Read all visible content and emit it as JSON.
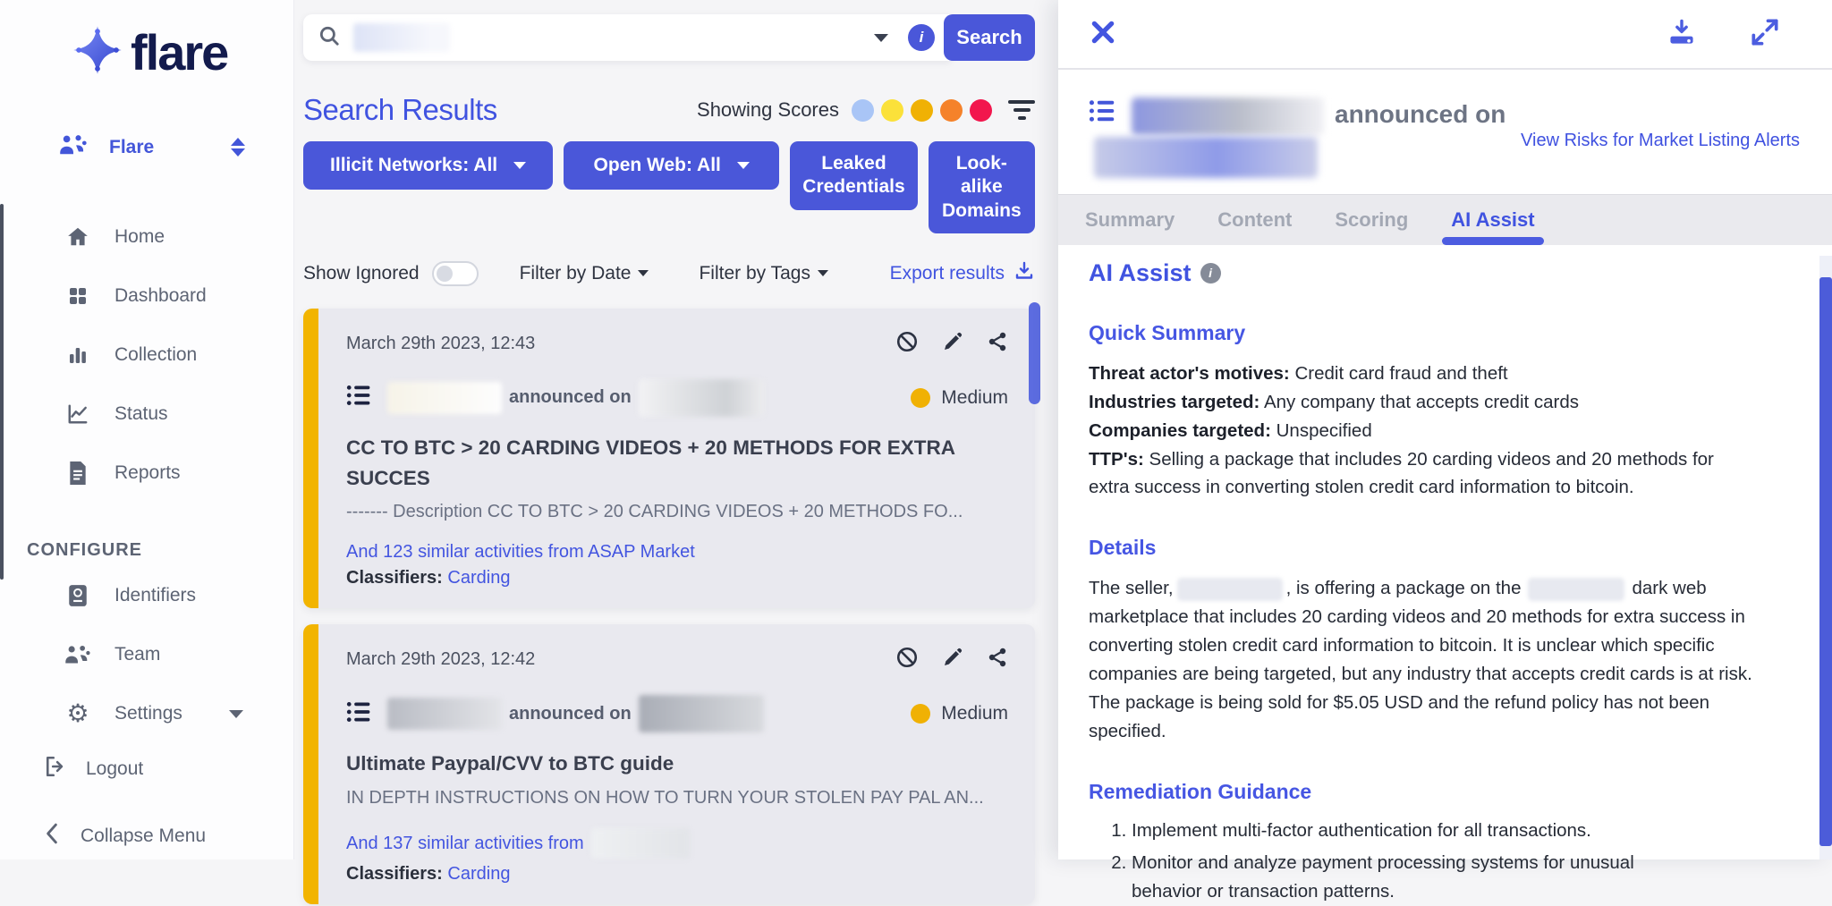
{
  "app": {
    "logo_text": "flare"
  },
  "sidebar": {
    "org": {
      "label": "Flare"
    },
    "items": [
      {
        "label": "Home"
      },
      {
        "label": "Dashboard"
      },
      {
        "label": "Collection"
      },
      {
        "label": "Status"
      },
      {
        "label": "Reports"
      }
    ],
    "configure_header": "CONFIGURE",
    "configure_items": [
      {
        "label": "Identifiers"
      },
      {
        "label": "Team"
      },
      {
        "label": "Settings"
      }
    ],
    "logout_label": "Logout",
    "collapse_label": "Collapse Menu"
  },
  "search_bar": {
    "button_label": "Search"
  },
  "results": {
    "heading": "Search Results",
    "showing_scores_label": "Showing Scores",
    "score_dot_colors": [
      "#a9c5f6",
      "#fbe13a",
      "#f0b104",
      "#f5822a",
      "#f2164d"
    ],
    "filter_buttons": [
      {
        "label": "Illicit Networks: All"
      },
      {
        "label": "Open Web: All"
      },
      {
        "label": "Leaked Credentials"
      },
      {
        "label": "Look-alike Domains"
      }
    ],
    "show_ignored_label": "Show Ignored",
    "filter_by_date_label": "Filter by Date",
    "filter_by_tags_label": "Filter by Tags",
    "export_label": "Export results",
    "accent_color": "#F2B400",
    "cards": [
      {
        "timestamp": "March 29th 2023, 12:43",
        "announced_label": "announced on",
        "severity": {
          "label": "Medium",
          "color": "#F0B104"
        },
        "title": "CC TO BTC > 20 CARDING VIDEOS + 20 METHODS FOR EXTRA SUCCES",
        "description": "------- Description CC TO BTC > 20 CARDING VIDEOS + 20 METHODS FO...",
        "similar_link": "And 123 similar activities from ASAP Market",
        "classifiers_label": "Classifiers:",
        "classifier": "Carding"
      },
      {
        "timestamp": "March 29th 2023, 12:42",
        "announced_label": "announced on",
        "severity": {
          "label": "Medium",
          "color": "#F0B104"
        },
        "title": "Ultimate Paypal/CVV to BTC guide",
        "description": "IN DEPTH INSTRUCTIONS ON HOW TO TURN YOUR STOLEN PAY PAL AN...",
        "similar_link": "And 137 similar activities from",
        "classifiers_label": "Classifiers:",
        "classifier": "Carding"
      }
    ]
  },
  "detail_panel": {
    "title": {
      "announced_word": "announced",
      "on_word": "on",
      "view_risks_link": "View Risks for Market Listing Alerts"
    },
    "tabs": [
      {
        "label": "Summary",
        "active": false
      },
      {
        "label": "Content",
        "active": false
      },
      {
        "label": "Scoring",
        "active": false
      },
      {
        "label": "AI Assist",
        "active": true
      }
    ],
    "heading": "AI Assist",
    "quick_summary": {
      "title": "Quick Summary",
      "rows": [
        {
          "label": "Threat actor's motives:",
          "text": "Credit card fraud and theft"
        },
        {
          "label": "Industries targeted:",
          "text": "Any company that accepts credit cards"
        },
        {
          "label": "Companies targeted:",
          "text": "Unspecified"
        },
        {
          "label": "TTP's:",
          "text": "Selling a package that includes 20 carding videos and 20 methods for extra success in converting stolen credit card information to bitcoin."
        }
      ]
    },
    "details": {
      "title": "Details",
      "before_seller": "The seller,",
      "after_seller": ", is offering a package on the",
      "after_market": "dark web marketplace that includes 20 carding videos and 20 methods for extra success in converting stolen credit card information to bitcoin. It is unclear which specific companies are being targeted, but any industry that accepts credit cards is at risk. The package is being sold for $5.05 USD and the refund policy has not been specified."
    },
    "remediation": {
      "title": "Remediation Guidance",
      "items": [
        "Implement multi-factor authentication for all transactions.",
        "Monitor and analyze payment processing systems for unusual behavior or transaction patterns."
      ]
    }
  }
}
